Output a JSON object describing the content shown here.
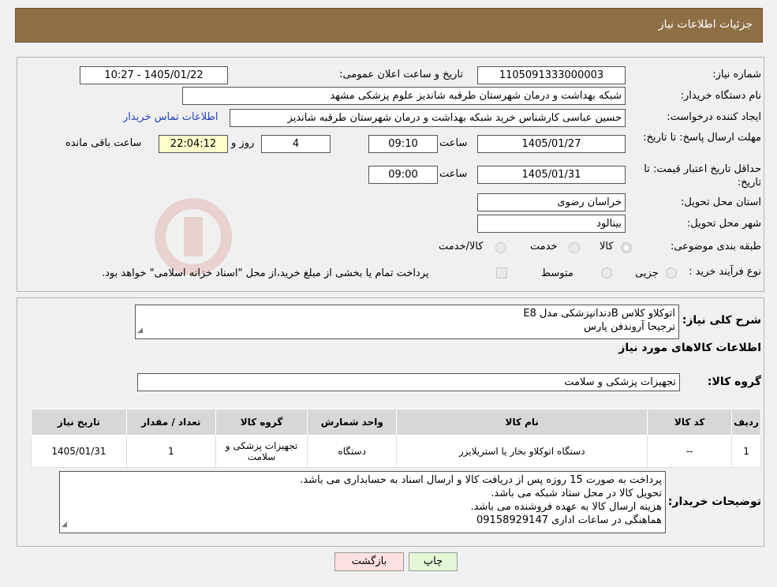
{
  "header": {
    "title": "جزئیات اطلاعات نیاز"
  },
  "form": {
    "need_number_label": "شماره نیاز:",
    "need_number": "1105091333000003",
    "announce_label": "تاریخ و ساعت اعلان عمومی:",
    "announce_value": "1405/01/22 - 10:27",
    "buyer_label": "نام دستگاه خریدار:",
    "buyer_value": "شبکه بهداشت و درمان شهرستان طرقبه شاندیز   علوم پزشکی مشهد",
    "creator_label": "ایجاد کننده درخواست:",
    "creator_value": "حسین عباسی کارشناس خرید شبکه بهداشت و درمان شهرستان طرقبه شاندیز",
    "contact_link": "اطلاعات تماس خریدار",
    "deadline_label": "مهلت ارسال پاسخ: تا تاریخ:",
    "deadline_date": "1405/01/27",
    "time_label": "ساعت",
    "deadline_time": "09:10",
    "days_value": "4",
    "days_label": "روز و",
    "remaining_time": "22:04:12",
    "remaining_label": "ساعت باقی مانده",
    "validity_label": "حداقل تاریخ اعتبار قیمت: تا تاریخ:",
    "validity_date": "1405/01/31",
    "validity_time": "09:00",
    "province_label": "استان محل تحویل:",
    "province_value": "خراسان رضوی",
    "city_label": "شهر محل تحویل:",
    "city_value": "بینالود",
    "category_label": "طبقه بندی موضوعی:",
    "category_options": [
      "کالا",
      "خدمت",
      "کالا/خدمت"
    ],
    "process_label": "نوع فرآیند خرید :",
    "process_options": [
      "جزیی",
      "متوسط"
    ],
    "process_note": "پرداخت تمام یا بخشی از مبلغ خرید،از محل \"اسناد خزانه اسلامی\" خواهد بود."
  },
  "details": {
    "desc_label": "شرح کلی نیاز:",
    "desc_lines": [
      "اتوکلاو کلاس Bدندانپزشکی مدل E8",
      "ترجیحا آروندفن پارس"
    ],
    "goods_info_title": "اطلاعات کالاهای مورد نیاز",
    "group_label": "گروه کالا:",
    "group_value": "تجهیزات پزشکی و سلامت"
  },
  "table": {
    "headers": [
      "ردیف",
      "کد کالا",
      "نام کالا",
      "واحد شمارش",
      "گروه کالا",
      "تعداد / مقدار",
      "تاریخ نیاز"
    ],
    "rows": [
      [
        "1",
        "--",
        "دستگاه اتوکلاو بخار یا استریلایزر",
        "دستگاه",
        "تجهیزات پزشکی و سلامت",
        "1",
        "1405/01/31"
      ]
    ]
  },
  "buyer_notes": {
    "label": "توضیحات خریدار:",
    "lines": [
      "پرداخت به صورت 15 روزه پس از دریافت کالا و ارسال اسناد به حسابداری می باشد.",
      "تحویل کالا در محل ستاد شبکه می باشد.",
      "هزینه ارسال کالا به عهده فروشنده می باشد.",
      "هماهنگی در ساعات اداری 09158929147"
    ]
  },
  "buttons": {
    "print": "چاپ",
    "back": "بازگشت"
  },
  "colors": {
    "header_bg": "#8e6f45",
    "yellow_field": "#ffffcc",
    "link": "#1f3fbf",
    "back_btn": "#fde0e0",
    "print_btn": "#e3f7d7"
  }
}
